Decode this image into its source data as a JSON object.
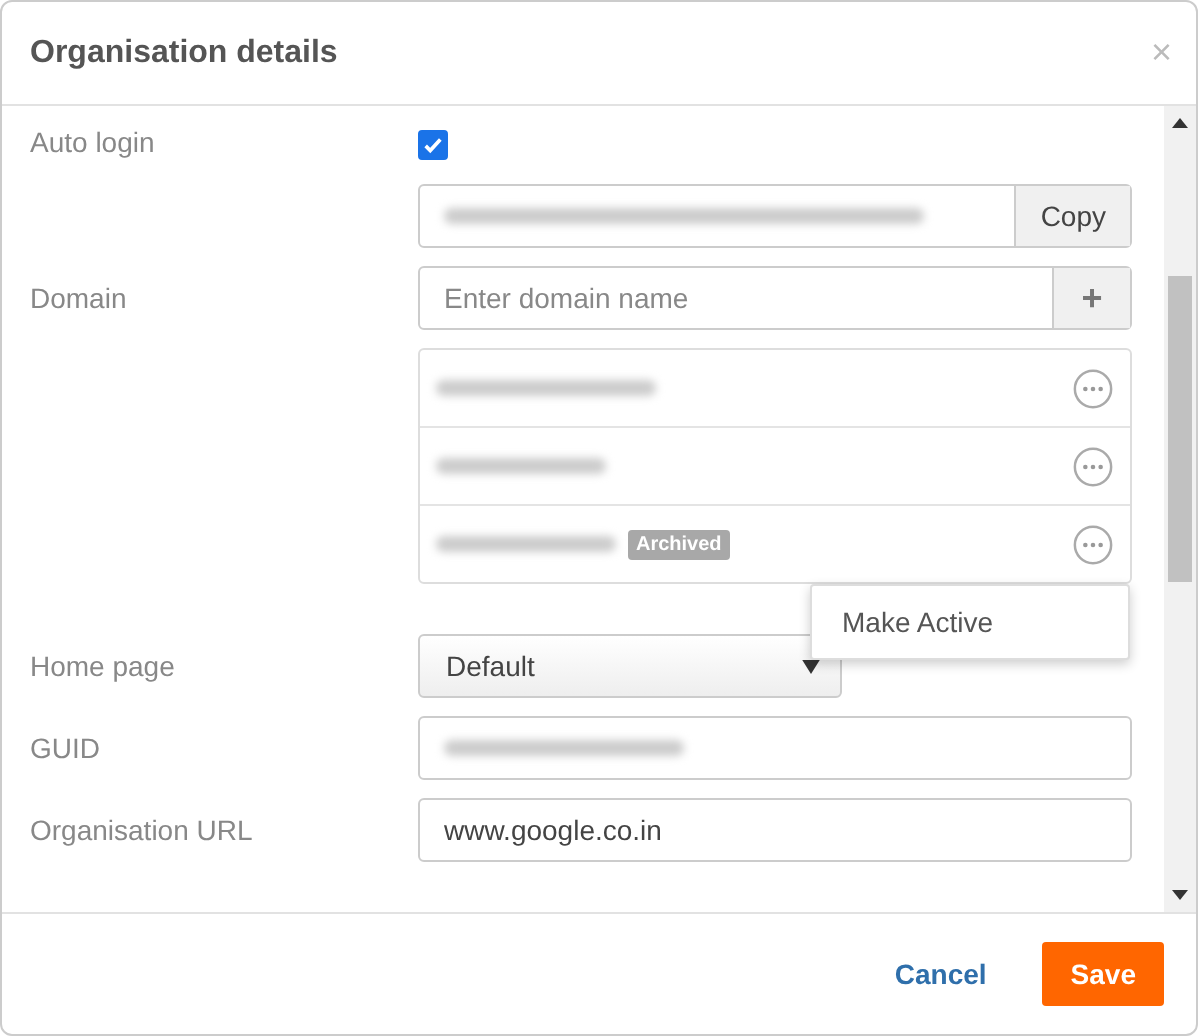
{
  "dialog": {
    "title": "Organisation details",
    "close": "×"
  },
  "auto_login": {
    "label": "Auto login",
    "checked": true
  },
  "login_url": {
    "copy_button": "Copy"
  },
  "domain": {
    "label": "Domain",
    "placeholder": "Enter domain name",
    "add_button": "+"
  },
  "domains": [
    {
      "archived": false
    },
    {
      "archived": false
    },
    {
      "archived": true
    }
  ],
  "archived_badge": "Archived",
  "context_menu": {
    "items": [
      "Make Active"
    ]
  },
  "home_page": {
    "label": "Home page",
    "value": "Default"
  },
  "guid": {
    "label": "GUID"
  },
  "organisation_url": {
    "label": "Organisation URL",
    "value": "www.google.co.in"
  },
  "footer": {
    "cancel": "Cancel",
    "save": "Save"
  }
}
